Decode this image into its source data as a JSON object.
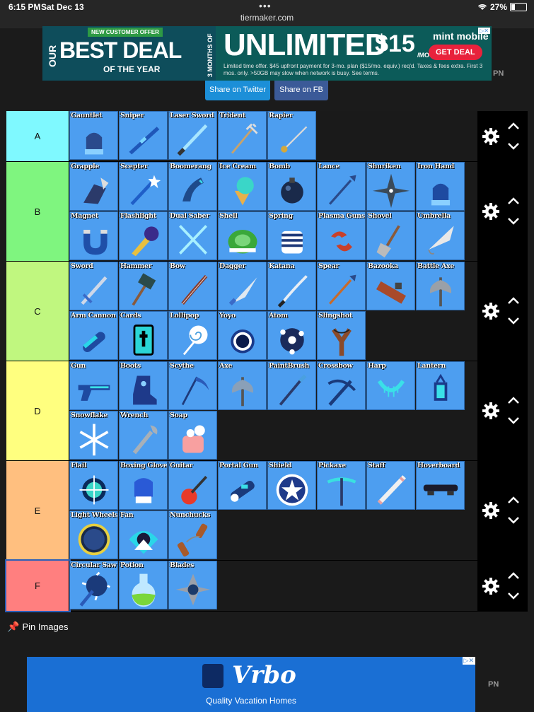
{
  "status_bar": {
    "time": "6:15 PM",
    "date": "Sat Dec 13",
    "url": "tiermaker.com",
    "battery": "27%"
  },
  "top_ad": {
    "offer": "NEW CUSTOMER OFFER",
    "our": "OUR",
    "best_deal": "BEST DEAL",
    "of_the_year": "OF THE YEAR",
    "months": "3 MONTHS OF",
    "unlimited": "UNLIMITED",
    "price": "$15",
    "per": "/MO",
    "brand": "mint mobile",
    "cta": "GET DEAL",
    "fine_print": "Limited time offer. $45 upfront payment for 3-mo. plan ($15/mo. equiv.) req'd. Taxes & fees extra. First 3 mos. only. >50GB may slow when network is busy. See terms.",
    "pn": "PN"
  },
  "share": {
    "twitter": "Share on Twitter",
    "facebook": "Share on FB"
  },
  "tiers": [
    {
      "label": "A",
      "color": "#7ff9ff",
      "items": [
        "Gauntlet",
        "Sniper",
        "Laser Sword",
        "Trident",
        "Rapier"
      ]
    },
    {
      "label": "B",
      "color": "#7ff57f",
      "items": [
        "Grapple",
        "Scepter",
        "Boomerang",
        "Ice Cream",
        "Bomb",
        "Lance",
        "Shuriken",
        "Iron Hand",
        "Magnet",
        "Flashlight",
        "Dual Saber",
        "Shell",
        "Spring",
        "Plasma Guns",
        "Shovel",
        "Umbrella"
      ]
    },
    {
      "label": "C",
      "color": "#c0f77f",
      "items": [
        "Sword",
        "Hammer",
        "Bow",
        "Dagger",
        "Katana",
        "Spear",
        "Bazooka",
        "Battle Axe",
        "Arm Cannon",
        "Cards",
        "Lollipop",
        "Yoyo",
        "Atom",
        "Slingshot"
      ]
    },
    {
      "label": "D",
      "color": "#ffff7f",
      "items": [
        "Gun",
        "Boots",
        "Scythe",
        "Axe",
        "PaintBrush",
        "Crossbow",
        "Harp",
        "Lantern",
        "Snowflake",
        "Wrench",
        "Soap"
      ]
    },
    {
      "label": "E",
      "color": "#ffbf7f",
      "items": [
        "Flail",
        "Boxing Gloves",
        "Guitar",
        "Portal Gun",
        "Shield",
        "Pickaxe",
        "Staff",
        "Hoverboard",
        "Light Wheels",
        "Fan",
        "Nunchucks"
      ]
    },
    {
      "label": "F",
      "color": "#ff7f7f",
      "items": [
        "Circular Saw",
        "Potion",
        "Blades"
      ]
    }
  ],
  "icons": {
    "Gauntlet": {
      "shape": "glove",
      "c": "#2a4a8c"
    },
    "Sniper": {
      "shape": "rifle",
      "c": "#1f56b8"
    },
    "Laser Sword": {
      "shape": "laser",
      "c": "#a8e6ff"
    },
    "Trident": {
      "shape": "trident",
      "c": "#c9a36a"
    },
    "Rapier": {
      "shape": "rapier",
      "c": "#d9d9d9"
    },
    "Grapple": {
      "shape": "claw",
      "c": "#2b3a6a"
    },
    "Scepter": {
      "shape": "wand",
      "c": "#1f5ec8"
    },
    "Boomerang": {
      "shape": "boomerang",
      "c": "#1e4a8a"
    },
    "Ice Cream": {
      "shape": "icecream",
      "c": "#3ad6c8"
    },
    "Bomb": {
      "shape": "bomb",
      "c": "#1a2a4a"
    },
    "Lance": {
      "shape": "spear",
      "c": "#2a4a8a"
    },
    "Shuriken": {
      "shape": "star",
      "c": "#3a4a5a"
    },
    "Iron Hand": {
      "shape": "glove",
      "c": "#1e4aa0"
    },
    "Magnet": {
      "shape": "magnet",
      "c": "#1f4fa8"
    },
    "Flashlight": {
      "shape": "flashlight",
      "c": "#3a2a8a"
    },
    "Dual Saber": {
      "shape": "x",
      "c": "#a8f0ff"
    },
    "Shell": {
      "shape": "shell",
      "c": "#3aa83a"
    },
    "Spring": {
      "shape": "spring",
      "c": "#1f3a7a"
    },
    "Plasma Guns": {
      "shape": "claws",
      "c": "#c8402a"
    },
    "Shovel": {
      "shape": "shovel",
      "c": "#8a5a3a"
    },
    "Umbrella": {
      "shape": "umbrella",
      "c": "#e8e8e8"
    },
    "Sword": {
      "shape": "sword",
      "c": "#cfd8e8"
    },
    "Hammer": {
      "shape": "hammer",
      "c": "#2a4a4a"
    },
    "Bow": {
      "shape": "bow",
      "c": "#8a3a2a"
    },
    "Dagger": {
      "shape": "dagger",
      "c": "#e0e8f0"
    },
    "Katana": {
      "shape": "katana",
      "c": "#e8eef5"
    },
    "Spear": {
      "shape": "spear",
      "c": "#c86a2a"
    },
    "Bazooka": {
      "shape": "bazooka",
      "c": "#a84a2a"
    },
    "Battle Axe": {
      "shape": "axe",
      "c": "#9aa0a8"
    },
    "Arm Cannon": {
      "shape": "cannon",
      "c": "#2ad6e8"
    },
    "Cards": {
      "shape": "card",
      "c": "#2ad6d6"
    },
    "Lollipop": {
      "shape": "lollipop",
      "c": "#ffffff"
    },
    "Yoyo": {
      "shape": "yoyo",
      "c": "#1a3a8a"
    },
    "Atom": {
      "shape": "atom",
      "c": "#1a2a5a"
    },
    "Slingshot": {
      "shape": "slingshot",
      "c": "#8a4a2a"
    },
    "Gun": {
      "shape": "gun",
      "c": "#1e4aa0"
    },
    "Boots": {
      "shape": "boot",
      "c": "#1e3a8a"
    },
    "Scythe": {
      "shape": "scythe",
      "c": "#1e3a7a"
    },
    "Axe": {
      "shape": "axe",
      "c": "#8aa0b8"
    },
    "PaintBrush": {
      "shape": "brush",
      "c": "#2a3a6a"
    },
    "Crossbow": {
      "shape": "crossbow",
      "c": "#1a3a7a"
    },
    "Harp": {
      "shape": "harp",
      "c": "#3ae0e8"
    },
    "Lantern": {
      "shape": "lantern",
      "c": "#1a3a8a"
    },
    "Snowflake": {
      "shape": "snowflake",
      "c": "#ffffff"
    },
    "Wrench": {
      "shape": "wrench",
      "c": "#a8b0b8"
    },
    "Soap": {
      "shape": "soap",
      "c": "#f8a0a0"
    },
    "Flail": {
      "shape": "flail",
      "c": "#3ad6c8"
    },
    "Boxing Gloves": {
      "shape": "boxing",
      "c": "#2a5ad6"
    },
    "Guitar": {
      "shape": "guitar",
      "c": "#e83a2a"
    },
    "Portal Gun": {
      "shape": "portal",
      "c": "#1a3a7a"
    },
    "Shield": {
      "shape": "shield",
      "c": "#1f3a8a"
    },
    "Pickaxe": {
      "shape": "pickaxe",
      "c": "#3ae0e0"
    },
    "Staff": {
      "shape": "staff",
      "c": "#f0f0f0"
    },
    "Hoverboard": {
      "shape": "board",
      "c": "#1a1a2a"
    },
    "Light Wheels": {
      "shape": "wheel",
      "c": "#1a2a4a"
    },
    "Fan": {
      "shape": "fan",
      "c": "#2ad6e8"
    },
    "Nunchucks": {
      "shape": "nunchucks",
      "c": "#a85a2a"
    },
    "Circular Saw": {
      "shape": "saw",
      "c": "#1a3a7a"
    },
    "Potion": {
      "shape": "potion",
      "c": "#7ad63a"
    },
    "Blades": {
      "shape": "blades",
      "c": "#9aa0aa"
    }
  },
  "pin_images": "Pin Images",
  "bottom_ad": {
    "brand": "Vrbo",
    "tagline": "Quality Vacation Homes",
    "pn": "PN"
  }
}
